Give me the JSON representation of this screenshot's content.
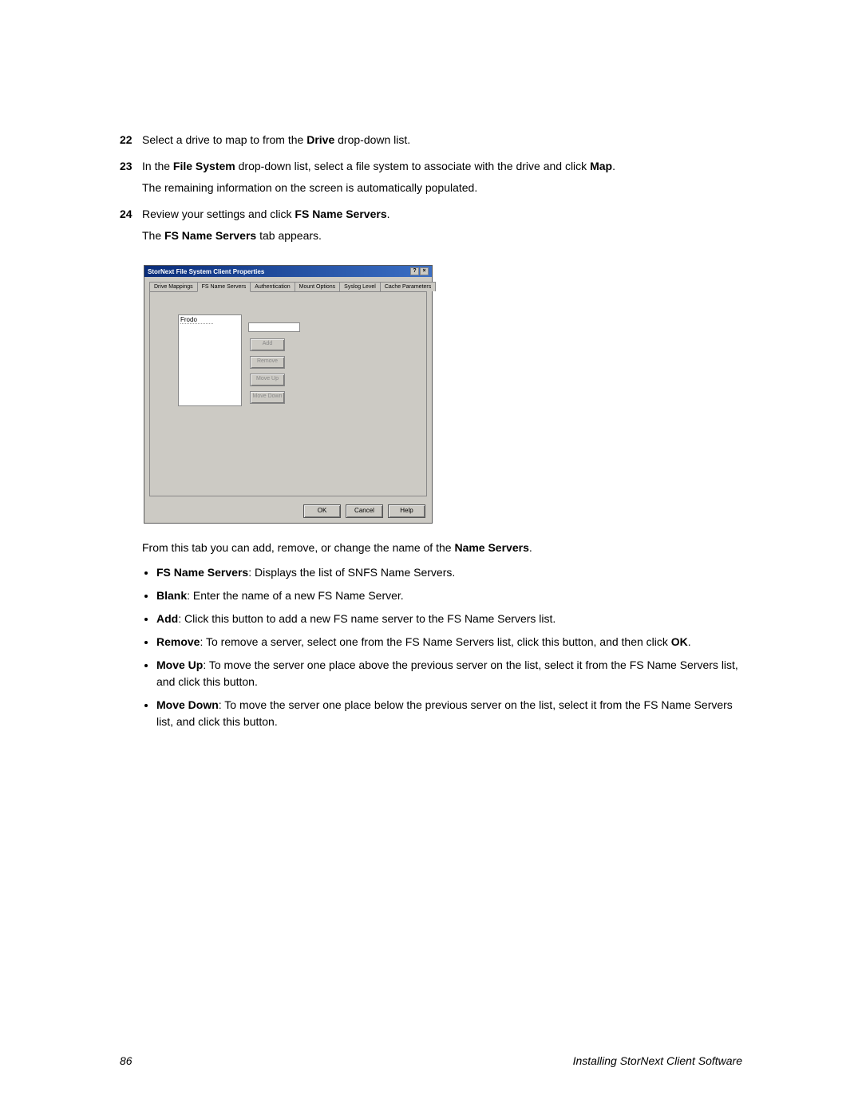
{
  "steps": {
    "s22": {
      "num": "22",
      "text_a": "Select a drive to map to from the ",
      "bold_a": "Drive",
      "text_b": " drop-down list."
    },
    "s23": {
      "num": "23",
      "text_a": "In the ",
      "bold_a": "File System",
      "text_b": " drop-down list, select a file system to associate with the drive and click ",
      "bold_b": "Map",
      "text_c": ".",
      "para2": "The remaining information on the screen is automatically populated."
    },
    "s24": {
      "num": "24",
      "text_a": "Review your settings and click ",
      "bold_a": "FS Name Servers",
      "text_b": ".",
      "para2_a": "The ",
      "para2_bold": "FS Name Servers",
      "para2_b": " tab appears."
    }
  },
  "dialog": {
    "title": "StorNext File System Client Properties",
    "win_help": "?",
    "win_close": "×",
    "tabs": {
      "t0": "Drive Mappings",
      "t1": "FS Name Servers",
      "t2": "Authentication",
      "t3": "Mount Options",
      "t4": "Syslog Level",
      "t5": "Cache Parameters"
    },
    "list_item": "Frodo",
    "buttons": {
      "add": "Add",
      "remove": "Remove",
      "moveup": "Move Up",
      "movedown": "Move Down",
      "ok": "OK",
      "cancel": "Cancel",
      "help": "Help"
    }
  },
  "after": {
    "intro_a": "From this tab you can add, remove, or change the name of the ",
    "intro_bold": "Name Servers",
    "intro_b": "."
  },
  "bullets": {
    "b1": {
      "bold": "FS Name Servers",
      "text": ": Displays the list of SNFS Name Servers."
    },
    "b2": {
      "bold": "Blank",
      "text": ": Enter the name of a new FS Name Server."
    },
    "b3": {
      "bold": "Add",
      "text": ": Click this button to add a new FS name server to the FS Name Servers list."
    },
    "b4": {
      "bold": "Remove",
      "text_a": ": To remove a server, select one from the FS Name Servers list, click this button, and then click ",
      "bold2": "OK",
      "text_b": "."
    },
    "b5": {
      "bold": "Move Up",
      "text": ": To move the server one place above the previous server on the list, select it from the FS Name Servers list, and click this button."
    },
    "b6": {
      "bold": "Move Down",
      "text": ": To move the server one place below the previous server on the list, select it from the FS Name Servers list, and click this button."
    }
  },
  "footer": {
    "page": "86",
    "title": "Installing StorNext Client Software"
  }
}
